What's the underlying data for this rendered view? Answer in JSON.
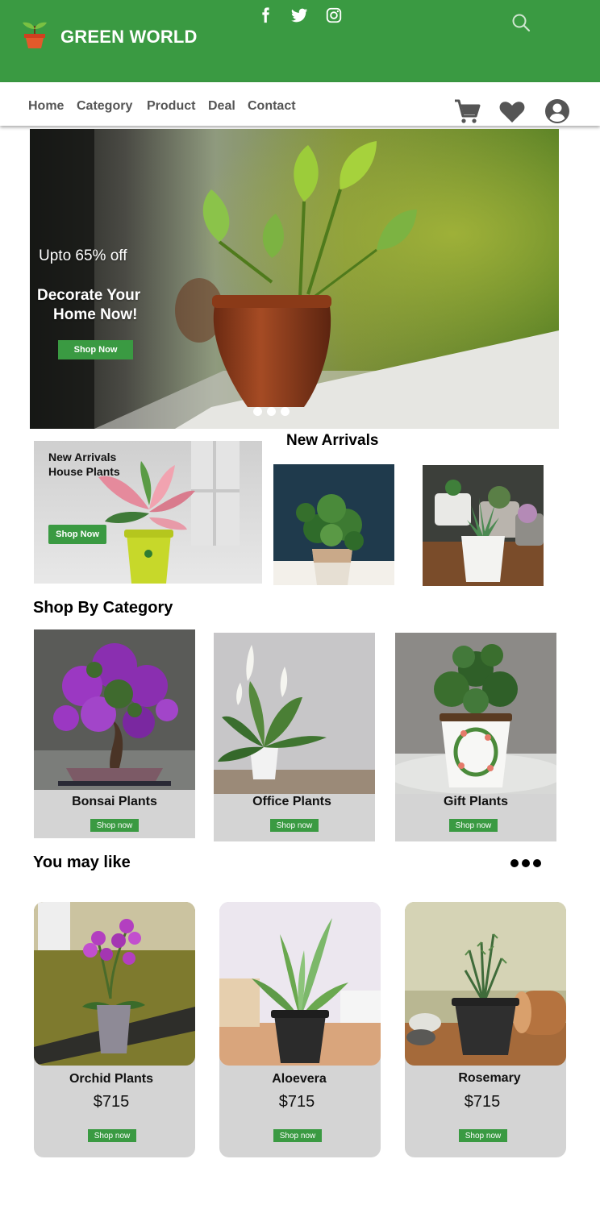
{
  "brand": {
    "name": "GREEN WORLD"
  },
  "header": {
    "social_icons": [
      "facebook-icon",
      "twitter-icon",
      "instagram-icon"
    ],
    "search_icon": "search-icon"
  },
  "nav": {
    "items": [
      "Home",
      "Category",
      "Product",
      "Deal",
      "Contact"
    ],
    "icons": [
      "cart-icon",
      "heart-icon",
      "account-icon"
    ]
  },
  "hero": {
    "offer": "Upto 65% off",
    "headline_line1": "Decorate Your",
    "headline_line2": "Home Now!",
    "button": "Shop Now",
    "carousel_dots": 3
  },
  "new_arrivals": {
    "heading": "New Arrivals",
    "promo_title_line1": "New Arrivals",
    "promo_title_line2": "House Plants",
    "promo_button": "Shop Now"
  },
  "categories": {
    "heading": "Shop By Category",
    "items": [
      {
        "name": "Bonsai Plants",
        "button": "Shop now"
      },
      {
        "name": "Office Plants",
        "button": "Shop now"
      },
      {
        "name": "Gift Plants",
        "button": "Shop now"
      }
    ]
  },
  "you_may_like": {
    "heading": "You may like",
    "more_icon": "more-dots-icon",
    "items": [
      {
        "name": "Orchid Plants",
        "price": "$715",
        "button": "Shop now"
      },
      {
        "name": "Aloevera",
        "price": "$715",
        "button": "Shop now"
      },
      {
        "name": "Rosemary",
        "price": "$715",
        "button": "Shop now"
      }
    ]
  },
  "colors": {
    "brand_green": "#3a9a42",
    "card_grey": "#d4d4d4",
    "nav_text": "#555555"
  }
}
